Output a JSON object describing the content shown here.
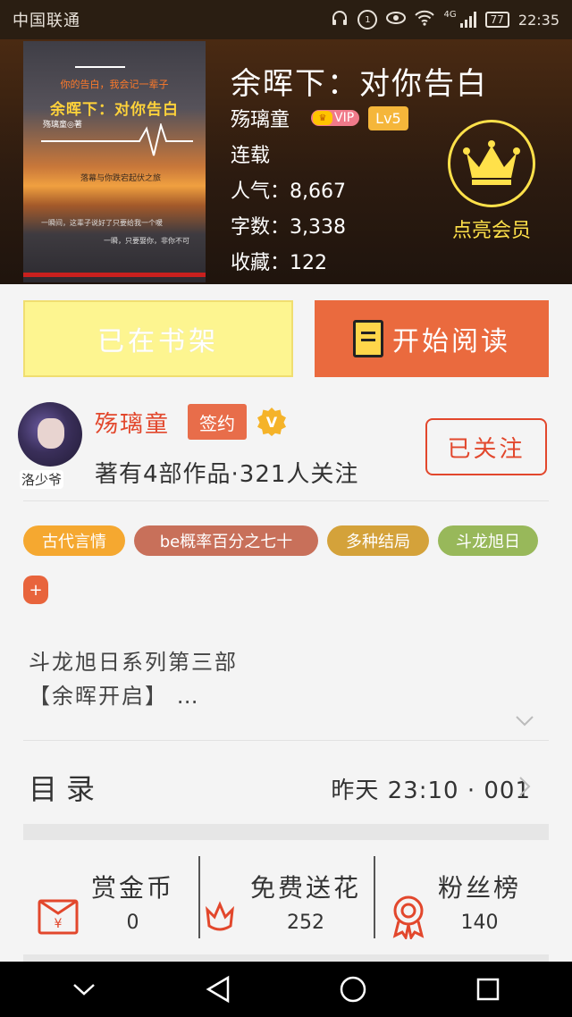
{
  "status_bar": {
    "carrier": "中国联通",
    "network": "4G",
    "battery": "77",
    "time": "22:35"
  },
  "book": {
    "title": "余晖下：对你告白",
    "author": "殇璃童",
    "vip_badge": "VIP",
    "level": "Lv5",
    "status": "连载",
    "popularity_label": "人气：",
    "popularity": "8,667",
    "word_count_label": "字数：",
    "word_count": "3,338",
    "favorites_label": "收藏：",
    "favorites": "122"
  },
  "cover": {
    "tagline": "你的告白，我会记一辈子",
    "title": "余晖下：对你告白",
    "author": "殇璃童◎著",
    "series_line": "落幕与你跌宕起伏之旅",
    "quote1": "一瞬间，这辈子说好了只要给我一个暖",
    "quote2": "一瞬，只要娶你，非你不可"
  },
  "member": {
    "label": "点亮会员"
  },
  "actions": {
    "shelf_label": "已在书架",
    "read_label": "开始阅读"
  },
  "author_panel": {
    "name": "殇璃童",
    "avatar_tag": "洛少爷",
    "signed_badge": "签约",
    "verified_badge": "V",
    "works_summary": "著有4部作品·321人关注",
    "follow_label": "已关注"
  },
  "tags": [
    {
      "label": "古代言情",
      "color": "#f5a830"
    },
    {
      "label": "be概率百分之七十",
      "color": "#c8705a"
    },
    {
      "label": "多种结局",
      "color": "#d4a23a"
    },
    {
      "label": "斗龙旭日",
      "color": "#98b85a"
    },
    {
      "label": "+",
      "color": "#e8643c"
    }
  ],
  "description": {
    "line1": "斗龙旭日系列第三部",
    "line2": "【余晖开启】 …"
  },
  "toc": {
    "label": "目录",
    "latest": "昨天 23:10 · 001"
  },
  "stats": [
    {
      "label": "赏金币",
      "value": "0",
      "icon": "red-envelope-icon"
    },
    {
      "label": "免费送花",
      "value": "252",
      "icon": "flower-icon"
    },
    {
      "label": "粉丝榜",
      "value": "140",
      "icon": "medal-icon"
    }
  ],
  "colors": {
    "accent": "#ea6a3e",
    "author_red": "#e2472c",
    "member_gold": "#ffe14a",
    "shelf_yellow": "#fdf590"
  }
}
